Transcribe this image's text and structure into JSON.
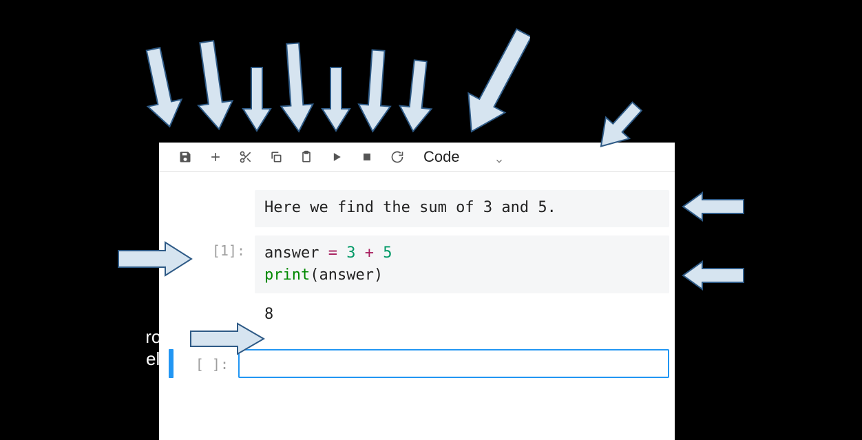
{
  "colors": {
    "arrow_fill": "#d6e4f0",
    "arrow_stroke": "#2e5a86",
    "accent_blue": "#2196f3",
    "code_bg": "#f5f6f7"
  },
  "toolbar": {
    "dropdown_label": "Code",
    "buttons": {
      "save": "save-icon",
      "add": "plus-icon",
      "cut": "scissors-icon",
      "copy": "copy-icon",
      "paste": "clipboard-icon",
      "run": "play-icon",
      "stop": "stop-icon",
      "restart": "restart-icon"
    }
  },
  "cells": {
    "markdown": {
      "text": "Here we find the sum of 3 and 5."
    },
    "code1": {
      "prompt": "[1]:",
      "tokens": {
        "var1": "answer",
        "op1": " = ",
        "num1": "3",
        "op2": " + ",
        "num2": "5",
        "fn": "print",
        "par_open": "(",
        "var2": "answer",
        "par_close": ")"
      },
      "output": "8"
    },
    "code2": {
      "prompt": "[ ]:",
      "content": ""
    }
  },
  "side_label": {
    "frag1": "rom",
    "frag2": "ell"
  }
}
